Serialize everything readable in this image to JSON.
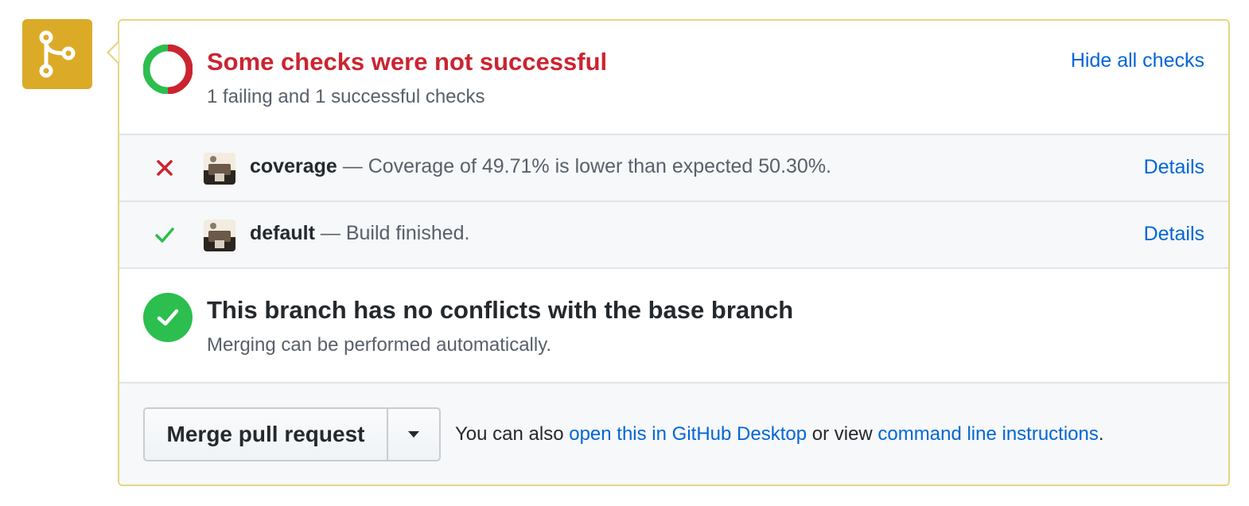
{
  "icons": {
    "merge": "git-merge-icon",
    "status": "status-donut-icon",
    "fail": "x-icon",
    "success": "check-icon",
    "branch_ok": "check-circle-icon",
    "dropdown": "caret-down-icon"
  },
  "colors": {
    "merge_icon_bg": "#dbab28",
    "panel_border": "#e6d482",
    "fail_red": "#cb2431",
    "success_green": "#2cbe4e",
    "link_blue": "#0366d6",
    "muted": "#586069"
  },
  "status": {
    "title": "Some checks were not successful",
    "subtitle": "1 failing and 1 successful checks",
    "hide_link": "Hide all checks",
    "failing": 1,
    "successful": 1
  },
  "checks": [
    {
      "state": "failure",
      "name": "coverage",
      "description": "— Coverage of 49.71% is lower than expected 50.30%.",
      "details_label": "Details"
    },
    {
      "state": "success",
      "name": "default",
      "description": "— Build finished.",
      "details_label": "Details"
    }
  ],
  "branch": {
    "title": "This branch has no conflicts with the base branch",
    "subtitle": "Merging can be performed automatically."
  },
  "merge": {
    "button_label": "Merge pull request",
    "note_prefix": "You can also ",
    "desktop_link": "open this in GitHub Desktop",
    "note_middle": " or view ",
    "cli_link": "command line instructions",
    "note_suffix": "."
  }
}
